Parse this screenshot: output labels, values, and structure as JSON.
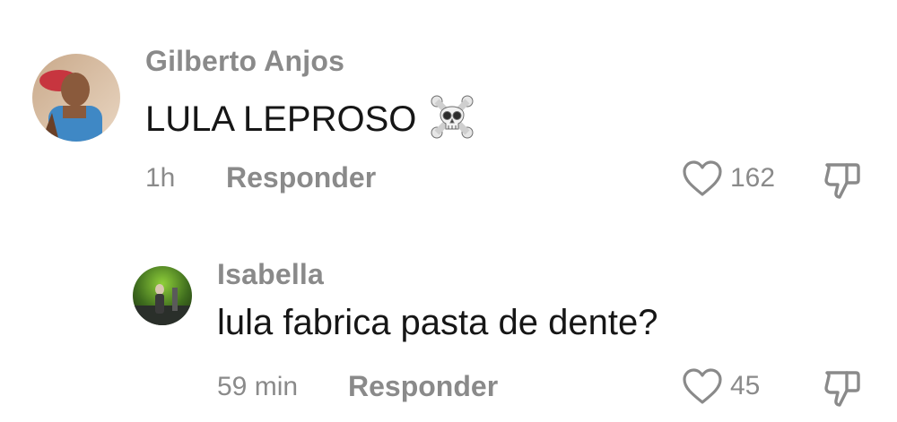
{
  "comments": [
    {
      "username": "Gilberto Anjos",
      "text": "LULA LEPROSO",
      "emoji_icon": "skull-and-crossbones-icon",
      "time": "1h",
      "reply_label": "Responder",
      "likes": "162"
    },
    {
      "username": "Isabella",
      "text": "lula fabrica pasta de dente?",
      "time": "59 min",
      "reply_label": "Responder",
      "likes": "45"
    }
  ]
}
